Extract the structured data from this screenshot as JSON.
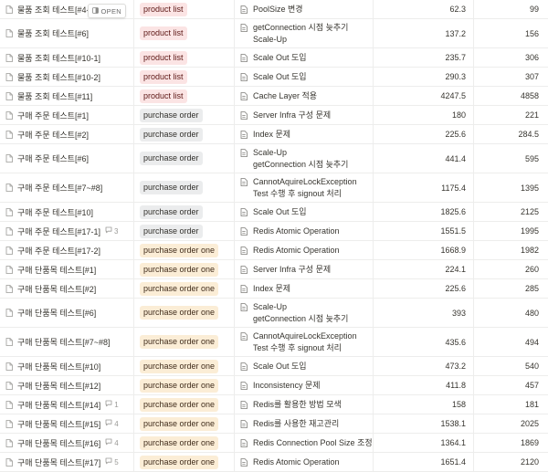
{
  "table": {
    "open_label": "OPEN",
    "tag_colors": {
      "red": "#fbe4e4",
      "gray": "#ebeced",
      "yellow": "#fbedd6"
    },
    "rows": [
      {
        "name": "물품 조회 테스트[#4-2]",
        "comments": "",
        "tag": "product list",
        "tag_color": "red",
        "mission": [
          "PoolSize 변경"
        ],
        "v1": "62.3",
        "v2": "99"
      },
      {
        "name": "물품 조회 테스트[#6]",
        "comments": "",
        "tag": "product list",
        "tag_color": "red",
        "mission": [
          "getConnection 시점 늦추기",
          "Scale-Up"
        ],
        "v1": "137.2",
        "v2": "156"
      },
      {
        "name": "물품 조회 테스트[#10-1]",
        "comments": "",
        "tag": "product list",
        "tag_color": "red",
        "mission": [
          "Scale Out 도입"
        ],
        "v1": "235.7",
        "v2": "306"
      },
      {
        "name": "물품 조회 테스트[#10-2]",
        "comments": "",
        "tag": "product list",
        "tag_color": "red",
        "mission": [
          "Scale Out 도입"
        ],
        "v1": "290.3",
        "v2": "307"
      },
      {
        "name": "물품 조회 테스트[#11]",
        "comments": "",
        "tag": "product list",
        "tag_color": "red",
        "mission": [
          "Cache Layer 적용"
        ],
        "v1": "4247.5",
        "v2": "4858"
      },
      {
        "name": "구매 주문 테스트[#1]",
        "comments": "",
        "tag": "purchase order",
        "tag_color": "gray",
        "mission": [
          "Server Infra 구성 문제"
        ],
        "v1": "180",
        "v2": "221"
      },
      {
        "name": "구매 주문 테스트[#2]",
        "comments": "",
        "tag": "purchase order",
        "tag_color": "gray",
        "mission": [
          "Index 문제"
        ],
        "v1": "225.6",
        "v2": "284.5"
      },
      {
        "name": "구매 주문 테스트[#6]",
        "comments": "",
        "tag": "purchase order",
        "tag_color": "gray",
        "mission": [
          "Scale-Up",
          "getConnection 시점 늦추기"
        ],
        "v1": "441.4",
        "v2": "595"
      },
      {
        "name": "구매 주문 테스트[#7~#8]",
        "comments": "",
        "tag": "purchase order",
        "tag_color": "gray",
        "mission": [
          "CannotAquireLockException",
          "Test 수행 후 signout 처리"
        ],
        "v1": "1175.4",
        "v2": "1395"
      },
      {
        "name": "구매 주문 테스트[#10]",
        "comments": "",
        "tag": "purchase order",
        "tag_color": "gray",
        "mission": [
          "Scale Out 도입"
        ],
        "v1": "1825.6",
        "v2": "2125"
      },
      {
        "name": "구매 주문 테스트[#17-1]",
        "comments": "3",
        "tag": "purchase order",
        "tag_color": "gray",
        "mission": [
          "Redis Atomic Operation"
        ],
        "v1": "1551.5",
        "v2": "1995"
      },
      {
        "name": "구매 주문 테스트[#17-2]",
        "comments": "",
        "tag": "purchase order one",
        "tag_color": "yellow",
        "mission": [
          "Redis Atomic Operation"
        ],
        "v1": "1668.9",
        "v2": "1982"
      },
      {
        "name": "구매 단품목 테스트[#1]",
        "comments": "",
        "tag": "purchase order one",
        "tag_color": "yellow",
        "mission": [
          "Server Infra 구성 문제"
        ],
        "v1": "224.1",
        "v2": "260"
      },
      {
        "name": "구매 단품목 테스트[#2]",
        "comments": "",
        "tag": "purchase order one",
        "tag_color": "yellow",
        "mission": [
          "Index 문제"
        ],
        "v1": "225.6",
        "v2": "285"
      },
      {
        "name": "구매 단품목 테스트[#6]",
        "comments": "",
        "tag": "purchase order one",
        "tag_color": "yellow",
        "mission": [
          "Scale-Up",
          "getConnection 시점 늦추기"
        ],
        "v1": "393",
        "v2": "480"
      },
      {
        "name": "구매 단품목 테스트[#7~#8]",
        "comments": "",
        "tag": "purchase order one",
        "tag_color": "yellow",
        "mission": [
          "CannotAquireLockException",
          "Test 수행 후 signout 처리"
        ],
        "v1": "435.6",
        "v2": "494"
      },
      {
        "name": "구매 단품목 테스트[#10]",
        "comments": "",
        "tag": "purchase order one",
        "tag_color": "yellow",
        "mission": [
          "Scale Out 도입"
        ],
        "v1": "473.2",
        "v2": "540"
      },
      {
        "name": "구매 단품목 테스트[#12]",
        "comments": "",
        "tag": "purchase order one",
        "tag_color": "yellow",
        "mission": [
          "Inconsistency 문제"
        ],
        "v1": "411.8",
        "v2": "457"
      },
      {
        "name": "구매 단품목 테스트[#14]",
        "comments": "1",
        "tag": "purchase order one",
        "tag_color": "yellow",
        "mission": [
          "Redis를 활용한 방법 모색"
        ],
        "v1": "158",
        "v2": "181"
      },
      {
        "name": "구매 단품목 테스트[#15]",
        "comments": "4",
        "tag": "purchase order one",
        "tag_color": "yellow",
        "mission": [
          "Redis를 사용한 재고관리"
        ],
        "v1": "1538.1",
        "v2": "2025"
      },
      {
        "name": "구매 단품목 테스트[#16]",
        "comments": "4",
        "tag": "purchase order one",
        "tag_color": "yellow",
        "mission": [
          "Redis Connection Pool Size 조정"
        ],
        "v1": "1364.1",
        "v2": "1869"
      },
      {
        "name": "구매 단품목 테스트[#17]",
        "comments": "5",
        "tag": "purchase order one",
        "tag_color": "yellow",
        "mission": [
          "Redis Atomic Operation"
        ],
        "v1": "1651.4",
        "v2": "2120"
      }
    ]
  }
}
